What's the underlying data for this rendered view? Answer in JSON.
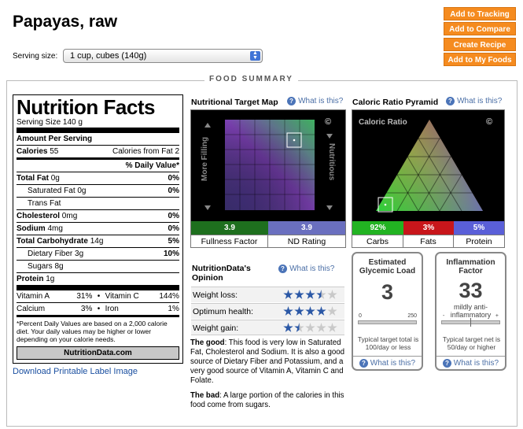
{
  "title": "Papayas, raw",
  "serving": {
    "label": "Serving size:",
    "value": "1 cup, cubes (140g)"
  },
  "actions": [
    "Add to Tracking",
    "Add to Compare",
    "Create Recipe",
    "Add to My Foods"
  ],
  "summary_title": "FOOD SUMMARY",
  "nf": {
    "heading": "Nutrition Facts",
    "serving_label": "Serving Size",
    "serving_value": "140 g",
    "amount": "Amount Per Serving",
    "calories_label": "Calories",
    "calories": "55",
    "cal_fat_label": "Calories from Fat",
    "cal_fat": "2",
    "dv_header": "% Daily Value*",
    "rows": [
      {
        "name": "Total Fat",
        "amt": "0g",
        "dv": "0%"
      },
      {
        "name": "Saturated Fat",
        "amt": "0g",
        "dv": "0%"
      },
      {
        "name": "Trans Fat",
        "amt": "",
        "dv": ""
      },
      {
        "name": "Cholesterol",
        "amt": "0mg",
        "dv": "0%"
      },
      {
        "name": "Sodium",
        "amt": "4mg",
        "dv": "0%"
      },
      {
        "name": "Total Carbohydrate",
        "amt": "14g",
        "dv": "5%"
      },
      {
        "name": "Dietary Fiber",
        "amt": "3g",
        "dv": "10%"
      },
      {
        "name": "Sugars",
        "amt": "8g",
        "dv": ""
      },
      {
        "name": "Protein",
        "amt": "1g",
        "dv": ""
      }
    ],
    "vitamins": [
      {
        "a": "Vitamin A",
        "av": "31%",
        "b": "Vitamin C",
        "bv": "144%"
      },
      {
        "a": "Calcium",
        "av": "3%",
        "b": "Iron",
        "bv": "1%"
      }
    ],
    "footnote": "*Percent Daily Values are based on a 2,000 calorie diet. Your daily values may be higher or lower depending on your calorie needs.",
    "brand": "NutritionData.com"
  },
  "download_link": "Download Printable Label Image",
  "what": "What is this?",
  "map": {
    "title": "Nutritional Target Map",
    "left_label": "More Filling",
    "right_label": "Nutritious",
    "fullness": "3.9",
    "nd": "3.9",
    "fullness_label": "Fullness Factor",
    "nd_label": "ND Rating"
  },
  "pyramid": {
    "title": "Caloric Ratio Pyramid",
    "inner_label": "Caloric Ratio",
    "carbs": "92%",
    "fats": "3%",
    "protein": "5%",
    "carbs_label": "Carbs",
    "fats_label": "Fats",
    "protein_label": "Protein"
  },
  "copyright": "©",
  "opinion": {
    "title": "NutritionData's Opinion",
    "rows": [
      {
        "label": "Weight loss:",
        "stars": 3.5
      },
      {
        "label": "Optimum health:",
        "stars": 4
      },
      {
        "label": "Weight gain:",
        "stars": 1.5
      }
    ]
  },
  "good": {
    "lead": "The good",
    "text": ": This food is very low in Saturated Fat, Cholesterol and Sodium. It is also a good source of Dietary Fiber and Potassium, and a very good source of Vitamin A, Vitamin C and Folate."
  },
  "bad": {
    "lead": "The bad",
    "text": ": A large portion of the calories in this food come from sugars."
  },
  "gl": {
    "title": "Estimated Glycemic Load",
    "value": "3",
    "min": "0",
    "max": "250",
    "note": "Typical target total is 100/day or less"
  },
  "inflam": {
    "title": "Inflammation Factor",
    "value": "33",
    "desc": "mildly anti-inflammatory",
    "min": "-",
    "max": "+",
    "note": "Typical target net is 50/day or higher"
  },
  "colors": {
    "orange": "#f58b1f",
    "link": "#1a4fa0",
    "carbs": "#22b322",
    "fats": "#c8161b",
    "protein": "#5a5fd8",
    "map_bar": "#1e6f1e",
    "nd_bar": "#6a6fbf"
  }
}
